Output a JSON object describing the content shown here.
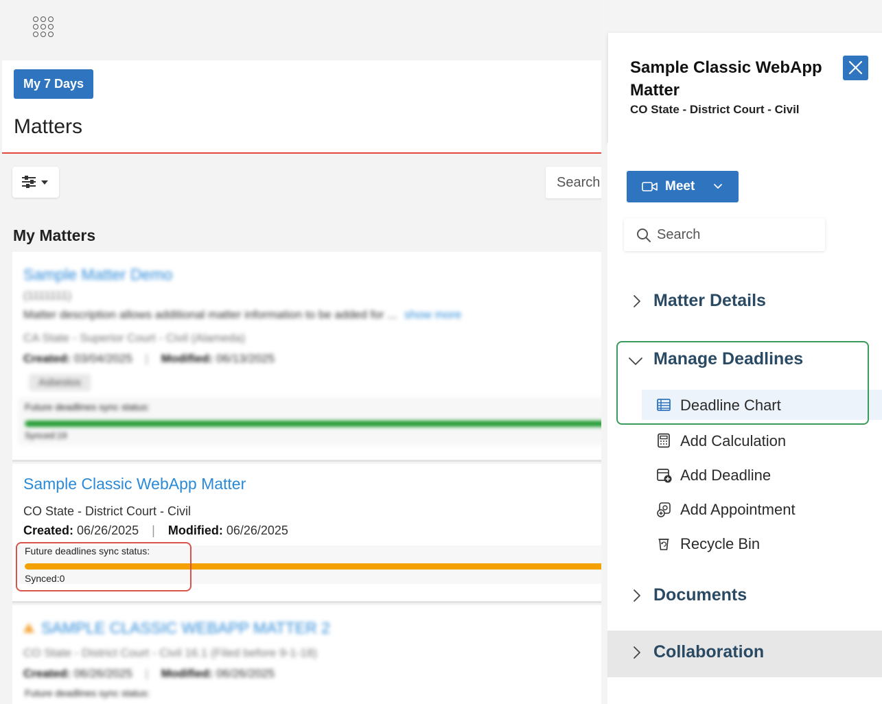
{
  "left": {
    "my7_label": "My 7 Days",
    "page_title": "Matters",
    "search_placeholder": "Search",
    "section_title": "My Matters",
    "matters": [
      {
        "title": "Sample Matter Demo",
        "number": "(1111111)",
        "description": "Matter description allows additional matter information to be added for ...",
        "show_more": "show more",
        "jurisdiction": "CA State - Superior Court - Civil (Alameda)",
        "created_label": "Created:",
        "created": "03/04/2025",
        "modified_label": "Modified:",
        "modified": "06/13/2025",
        "tag": "Asbestos",
        "sync_label": "Future deadlines sync status:",
        "sync_progress": 1.0,
        "sync_color": "#1f9a2e",
        "synced_text": "Synced:19"
      },
      {
        "title": "Sample Classic WebApp Matter",
        "jurisdiction": "CO State - District Court - Civil",
        "created_label": "Created:",
        "created": "06/26/2025",
        "modified_label": "Modified:",
        "modified": "06/26/2025",
        "sync_label": "Future deadlines sync status:",
        "sync_progress": 1.0,
        "sync_color": "#f4a100",
        "synced_text": "Synced:0"
      },
      {
        "title": "SAMPLE CLASSIC WEBAPP MATTER 2",
        "jurisdiction": "CO State - District Court - Civil 16.1 (Filed before 9-1-18)",
        "created_label": "Created:",
        "created": "06/26/2025",
        "modified_label": "Modified:",
        "modified": "06/26/2025",
        "sync_label": "Future deadlines sync status:"
      }
    ]
  },
  "right": {
    "title": "Sample Classic WebApp Matter",
    "subtitle": "CO State - District Court - Civil",
    "meet_label": "Meet",
    "search_placeholder": "Search",
    "sections": {
      "matter_details": "Matter Details",
      "manage_deadlines": "Manage Deadlines",
      "documents": "Documents",
      "collaboration": "Collaboration"
    },
    "deadline_items": {
      "deadline_chart": "Deadline Chart",
      "add_calculation": "Add Calculation",
      "add_deadline": "Add Deadline",
      "add_appointment": "Add Appointment",
      "recycle_bin": "Recycle Bin"
    }
  },
  "colors": {
    "primary_blue": "#2f74be",
    "link_blue": "#2b8ad8",
    "header_red": "#e3473a",
    "highlight_red": "#d9534a",
    "highlight_green": "#3a9a5a",
    "nav_text": "#2a4a63"
  }
}
